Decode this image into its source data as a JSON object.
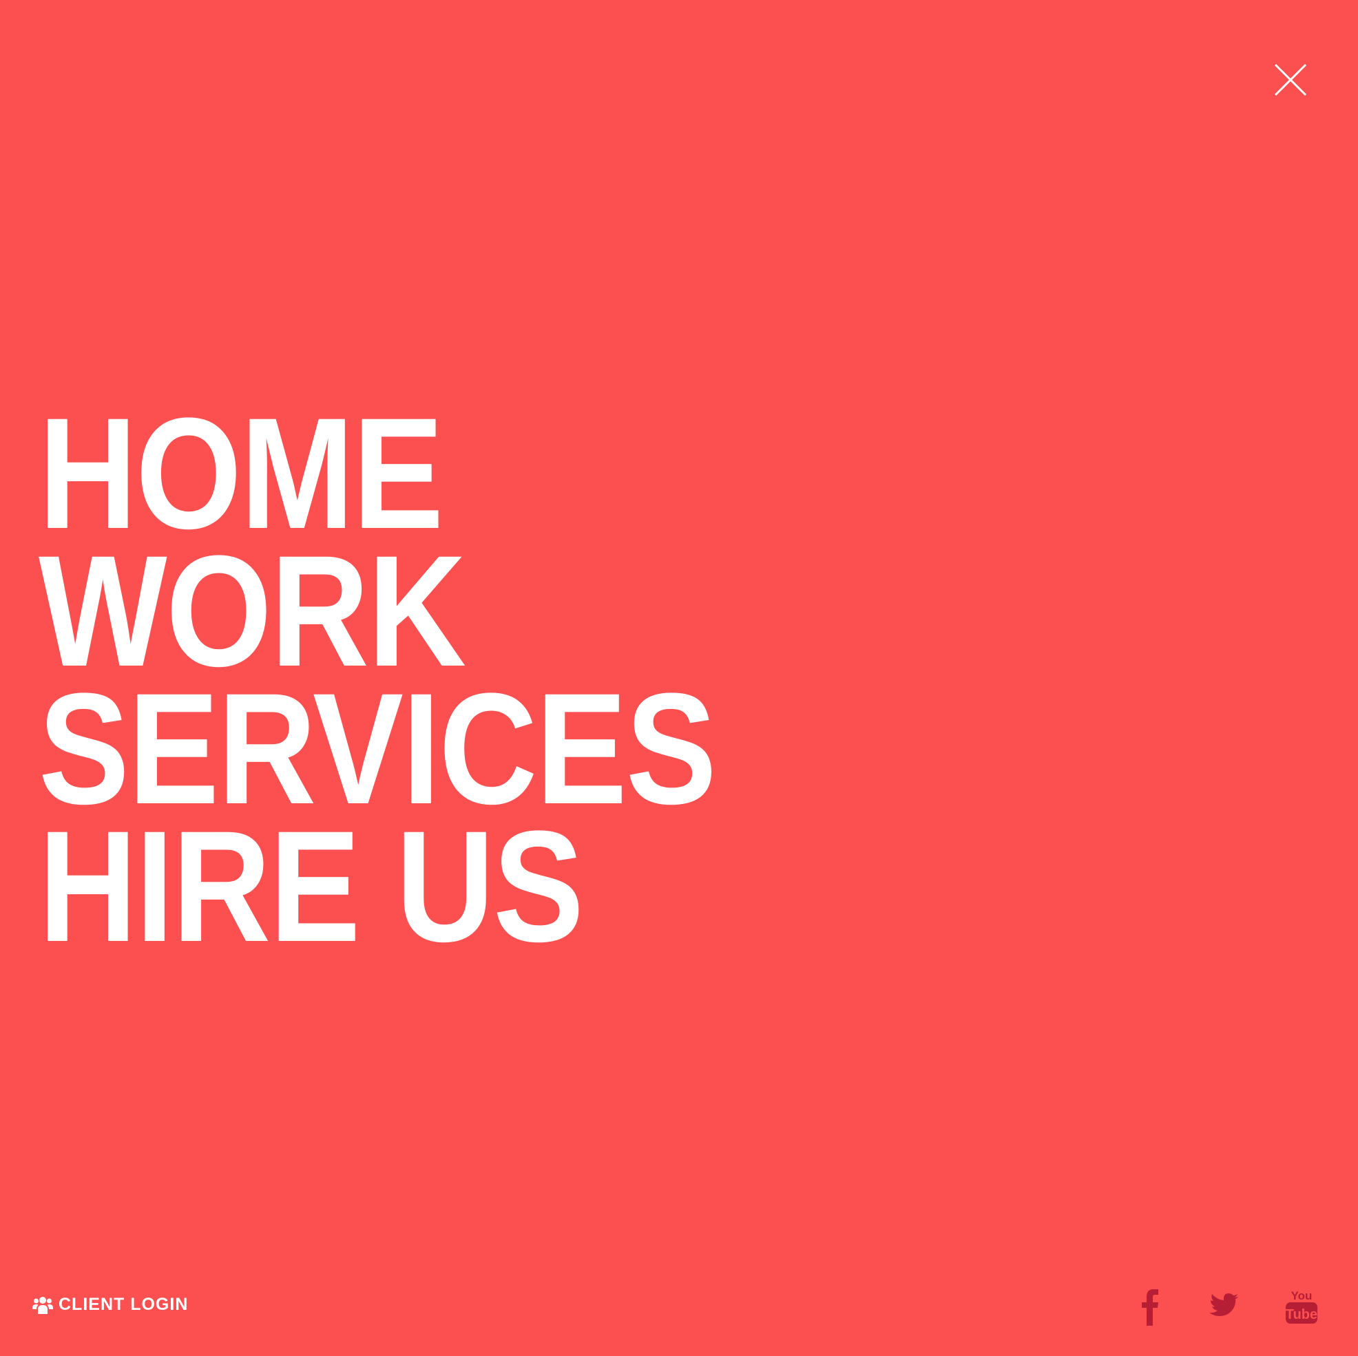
{
  "menu": {
    "items": [
      {
        "label": "HOME"
      },
      {
        "label": "WORK"
      },
      {
        "label": "SERVICES"
      },
      {
        "label": "HIRE US"
      }
    ]
  },
  "footer": {
    "client_login_label": "CLIENT LOGIN",
    "client_login_icon": "users-icon"
  },
  "social": {
    "icons": [
      "facebook-icon",
      "twitter-icon",
      "youtube-icon"
    ]
  },
  "colors": {
    "background": "#fc5050",
    "text": "#ffffff",
    "social_icon": "#b51e35"
  },
  "close_icon": "close-icon"
}
